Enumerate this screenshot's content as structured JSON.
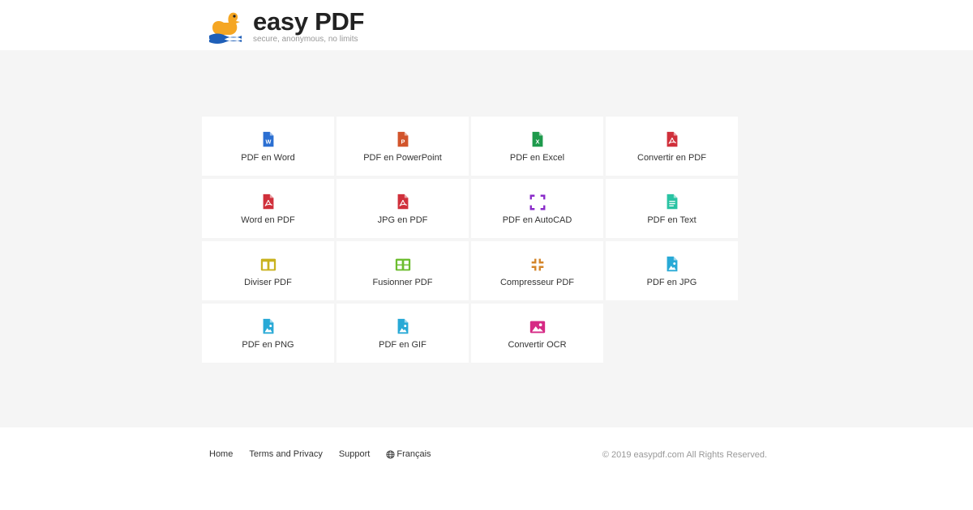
{
  "header": {
    "brand_name": "easy PDF",
    "tagline": "secure, anonymous, no limits"
  },
  "tools": [
    {
      "label": "PDF en Word",
      "icon": "word-file-icon",
      "color": "#2b6fd2"
    },
    {
      "label": "PDF en PowerPoint",
      "icon": "powerpoint-file-icon",
      "color": "#d2542b"
    },
    {
      "label": "PDF en Excel",
      "icon": "excel-file-icon",
      "color": "#1e9a4c"
    },
    {
      "label": "Convertir en PDF",
      "icon": "pdf-file-icon",
      "color": "#d0303b"
    },
    {
      "label": "Word en PDF",
      "icon": "pdf-file-icon",
      "color": "#d0303b"
    },
    {
      "label": "JPG en PDF",
      "icon": "pdf-file-icon",
      "color": "#d0303b"
    },
    {
      "label": "PDF en AutoCAD",
      "icon": "autocad-frame-icon",
      "color": "#8a2bc9"
    },
    {
      "label": "PDF en Text",
      "icon": "text-file-icon",
      "color": "#29c3a3"
    },
    {
      "label": "Diviser PDF",
      "icon": "split-icon",
      "color": "#c9b21f"
    },
    {
      "label": "Fusionner PDF",
      "icon": "merge-icon",
      "color": "#6cbd2f"
    },
    {
      "label": "Compresseur PDF",
      "icon": "compress-icon",
      "color": "#d4852a"
    },
    {
      "label": "PDF en JPG",
      "icon": "image-file-icon",
      "color": "#28a9d6"
    },
    {
      "label": "PDF en PNG",
      "icon": "image-file-icon",
      "color": "#28a9d6"
    },
    {
      "label": "PDF en GIF",
      "icon": "image-file-icon",
      "color": "#28a9d6"
    },
    {
      "label": "Convertir OCR",
      "icon": "ocr-image-icon",
      "color": "#d62a85"
    }
  ],
  "footer": {
    "links": [
      {
        "label": "Home"
      },
      {
        "label": "Terms and Privacy"
      },
      {
        "label": "Support"
      },
      {
        "label": "Français",
        "icon": "globe-icon"
      }
    ],
    "copyright": "© 2019 easypdf.com All Rights Reserved."
  }
}
